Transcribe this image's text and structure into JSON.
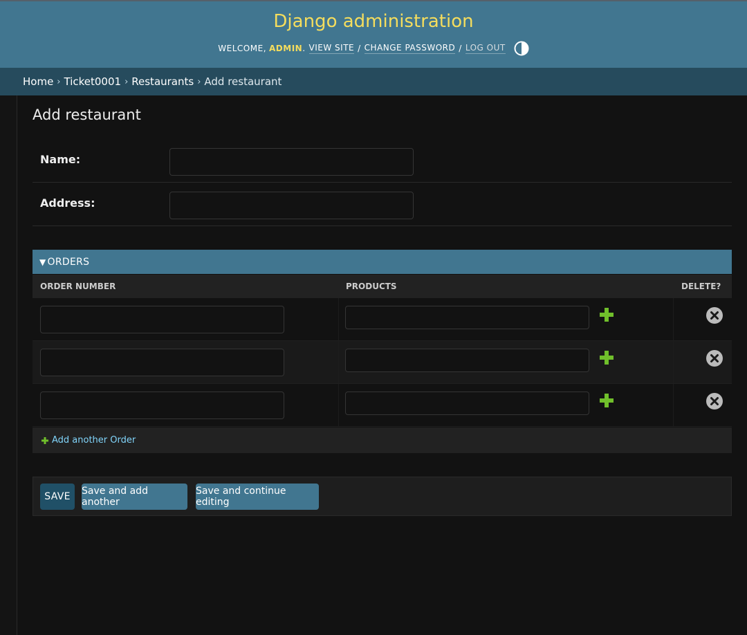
{
  "header": {
    "title": "Django administration",
    "welcome": "WELCOME,",
    "username": "ADMIN",
    "username_suffix": ".",
    "view_site": "VIEW SITE",
    "change_password": "CHANGE PASSWORD",
    "log_out": "LOG OUT",
    "separator": "/",
    "theme_toggle_icon": "contrast-half-circle-icon"
  },
  "breadcrumbs": {
    "items": [
      "Home",
      "Ticket0001",
      "Restaurants"
    ],
    "current": "Add restaurant",
    "separator": "›"
  },
  "page": {
    "title": "Add restaurant"
  },
  "form": {
    "fields": [
      {
        "label": "Name:",
        "value": ""
      },
      {
        "label": "Address:",
        "value": ""
      }
    ]
  },
  "inline": {
    "title": "ORDERS",
    "toggle_icon": "triangle-down-icon",
    "columns": [
      "ORDER NUMBER",
      "PRODUCTS",
      "DELETE?"
    ],
    "rows": [
      {
        "order_number": "",
        "products": ""
      },
      {
        "order_number": "",
        "products": ""
      },
      {
        "order_number": "",
        "products": ""
      }
    ],
    "add_label": "Add another Order"
  },
  "submit": {
    "save": "SAVE",
    "save_add_another": "Save and add another",
    "save_continue": "Save and continue editing"
  },
  "colors": {
    "header_bg": "#417690",
    "branding": "#f5dd5d",
    "breadcrumbs_bg": "#264b5d",
    "add_green": "#70bf2b",
    "delete_gray": "#bbbbbb",
    "link_blue": "#81d4fa",
    "primary_button": "#205067"
  }
}
